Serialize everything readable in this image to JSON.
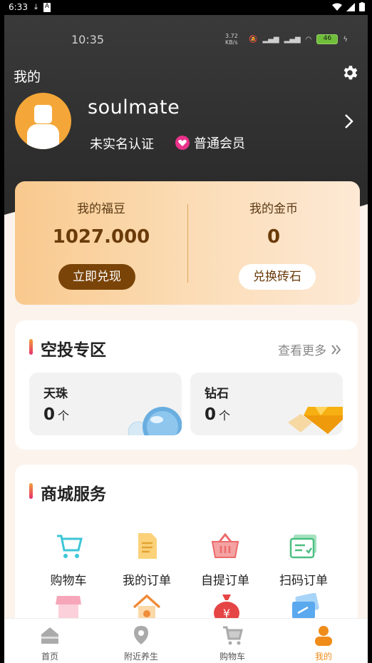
{
  "system_bar": {
    "time": "6:33",
    "icons": [
      "download-icon",
      "a-icon"
    ],
    "right_icons": [
      "wifi-icon",
      "signal-icon",
      "battery-icon"
    ]
  },
  "inner_status": {
    "time": "10:35",
    "speed": "3.72 KB/s",
    "battery": "46"
  },
  "header": {
    "title": "我的"
  },
  "profile": {
    "username": "soulmate",
    "verify_status": "未实名认证",
    "member_level": "普通会员"
  },
  "wallet": {
    "fudou": {
      "label": "我的福豆",
      "value": "1027.000",
      "button": "立即兑现"
    },
    "gold": {
      "label": "我的金币",
      "value": "0",
      "button": "兑换砖石"
    }
  },
  "airdrop": {
    "title": "空投专区",
    "more": "查看更多",
    "items": [
      {
        "name": "天珠",
        "value": "0",
        "unit": "个"
      },
      {
        "name": "钻石",
        "value": "0",
        "unit": "个"
      }
    ]
  },
  "mall": {
    "title": "商城服务",
    "items": [
      {
        "label": "购物车"
      },
      {
        "label": "我的订单"
      },
      {
        "label": "自提订单"
      },
      {
        "label": "扫码订单"
      }
    ]
  },
  "tabbar": {
    "items": [
      {
        "label": "首页"
      },
      {
        "label": "附近养生"
      },
      {
        "label": "购物车"
      },
      {
        "label": "我的"
      }
    ],
    "active_color": "#f08c1a"
  },
  "colors": {
    "gold_button": "#7a4408",
    "accent": "#f4a638",
    "member_badge": "#e8328a"
  }
}
